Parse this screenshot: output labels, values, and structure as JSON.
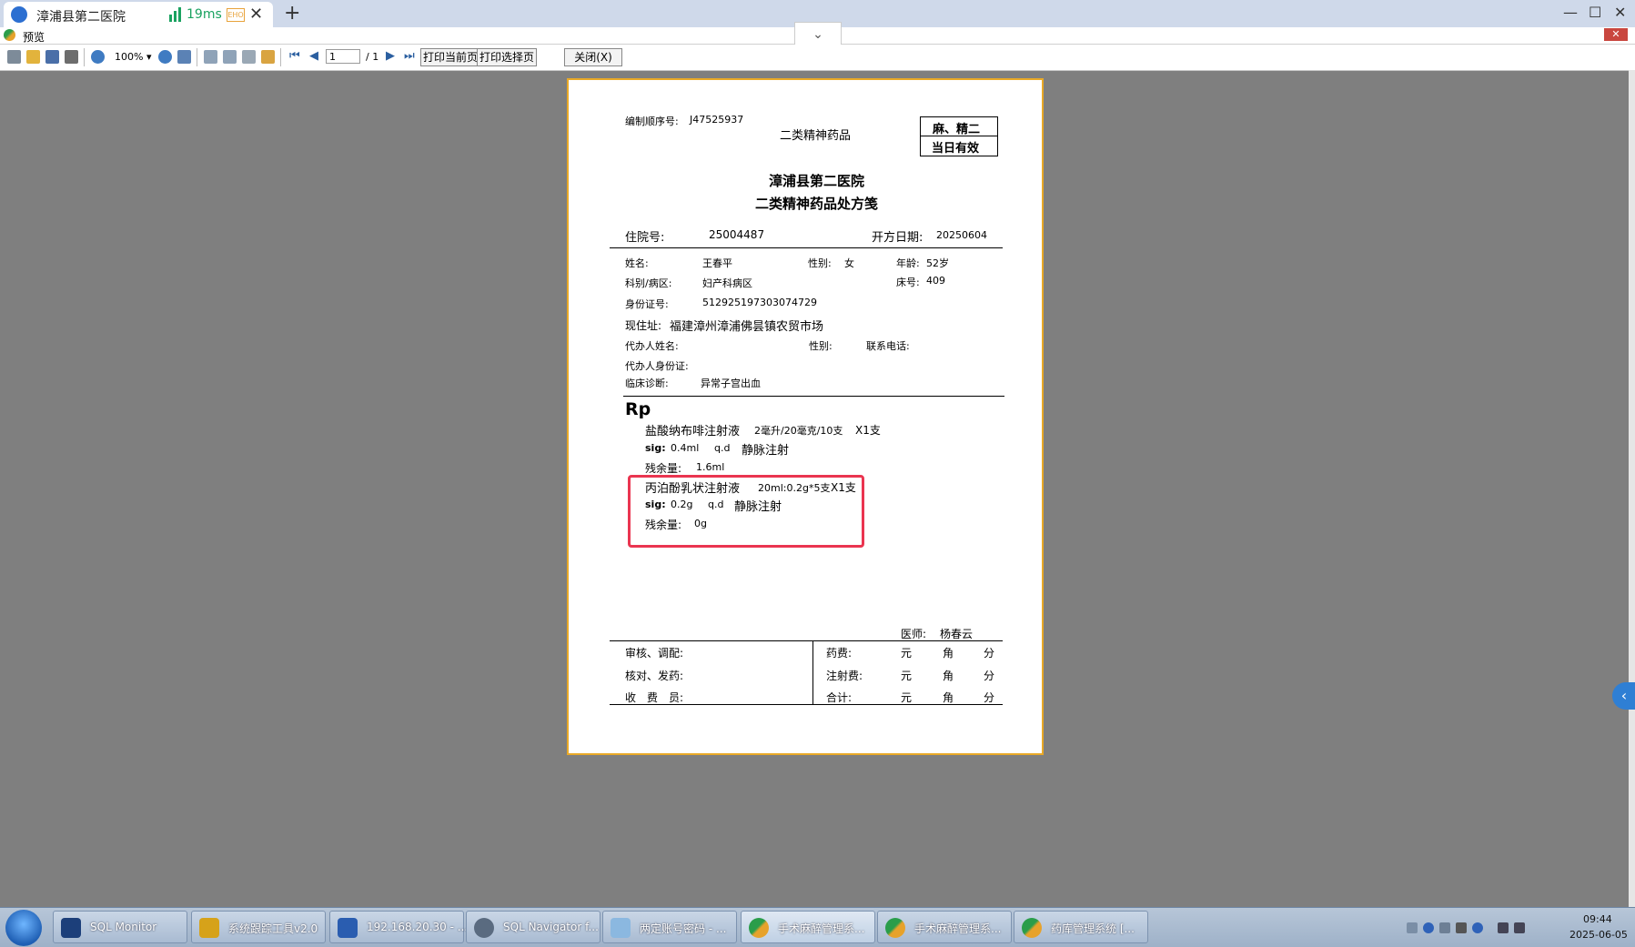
{
  "browser": {
    "tab_title": "漳浦县第二医院",
    "latency": "19ms",
    "badge": "EHO",
    "close_glyph": "✕",
    "new_tab_glyph": "+",
    "window_controls": [
      "—",
      "☐",
      "✕"
    ]
  },
  "window": {
    "title": "预览",
    "close_glyph": "✕",
    "dropdown_glyph": "⌄"
  },
  "toolbar": {
    "zoom": "100% ▾",
    "page_input": "1",
    "page_total": "/ 1",
    "print_current_label": "打印当前页",
    "print_selected_label": "打印选择页",
    "close_label": "关闭(X)"
  },
  "prescription": {
    "serial_label": "编制顺序号:",
    "serial_value": "J47525937",
    "category_top": "二类精神药品",
    "box_line1": "麻、精二",
    "box_line2": "当日有效",
    "hospital": "漳浦县第二医院",
    "form_title": "二类精神药品处方笺",
    "inpatient_label": "住院号:",
    "inpatient_value": "25004487",
    "date_label": "开方日期:",
    "date_value": "20250604",
    "name_label": "姓名:",
    "name_value": "王春平",
    "sex_label": "性别:",
    "sex_value": "女",
    "age_label": "年龄:",
    "age_value": "52岁",
    "dept_label": "科别/病区:",
    "dept_value": "妇产科病区",
    "bed_label": "床号:",
    "bed_value": "409",
    "id_label": "身份证号:",
    "id_value": "512925197303074729",
    "address_label": "现住址:",
    "address_value": "福建漳州漳浦佛昙镇农贸市场",
    "agent_name_label": "代办人姓名:",
    "agent_sex_label": "性别:",
    "phone_label": "联系电话:",
    "agent_id_label": "代办人身份证:",
    "diagnosis_label": "临床诊断:",
    "diagnosis_value": "异常子宫出血",
    "rp": "Rp",
    "drugs": [
      {
        "name": "盐酸纳布啡注射液",
        "spec": "2毫升/20毫克/10支",
        "qty": "X1支",
        "sig_label": "sig:",
        "dose": "0.4ml",
        "freq": "q.d",
        "route": "静脉注射",
        "remain_label": "残余量:",
        "remain": "1.6ml"
      },
      {
        "name": "丙泊酚乳状注射液",
        "spec": "20ml:0.2g*5支",
        "qty": "X1支",
        "sig_label": "sig:",
        "dose": "0.2g",
        "freq": "q.d",
        "route": "静脉注射",
        "remain_label": "残余量:",
        "remain": "0g"
      }
    ],
    "doctor_label": "医师:",
    "doctor_value": "杨春云",
    "footer": {
      "review": "审核、调配:",
      "check": "核对、发药:",
      "cashier": "收　费　员:",
      "drug_fee": "药费:",
      "injection_fee": "注射费:",
      "total": "合计:",
      "yuan": "元",
      "jiao": "角",
      "fen": "分"
    }
  },
  "side_arrow_glyph": "‹",
  "taskbar": {
    "items": [
      {
        "label": "SQL Monitor",
        "color": "#1c3f7a"
      },
      {
        "label": "系统跟踪工具v2.0",
        "color": "#d6a21a"
      },
      {
        "label": "192.168.20.30 - ...",
        "color": "#2a5db0"
      },
      {
        "label": "SQL Navigator f...",
        "color": "#5a6b80"
      },
      {
        "label": "两定账号密码 - ...",
        "color": "#8bb8e0"
      },
      {
        "label": "手术麻醉管理系...",
        "color": "#2a9d4a"
      },
      {
        "label": "手术麻醉管理系...",
        "color": "#2a9d4a"
      },
      {
        "label": "药库管理系统 [...",
        "color": "#2a9d4a"
      }
    ],
    "time": "09:44",
    "date": "2025-06-05"
  }
}
